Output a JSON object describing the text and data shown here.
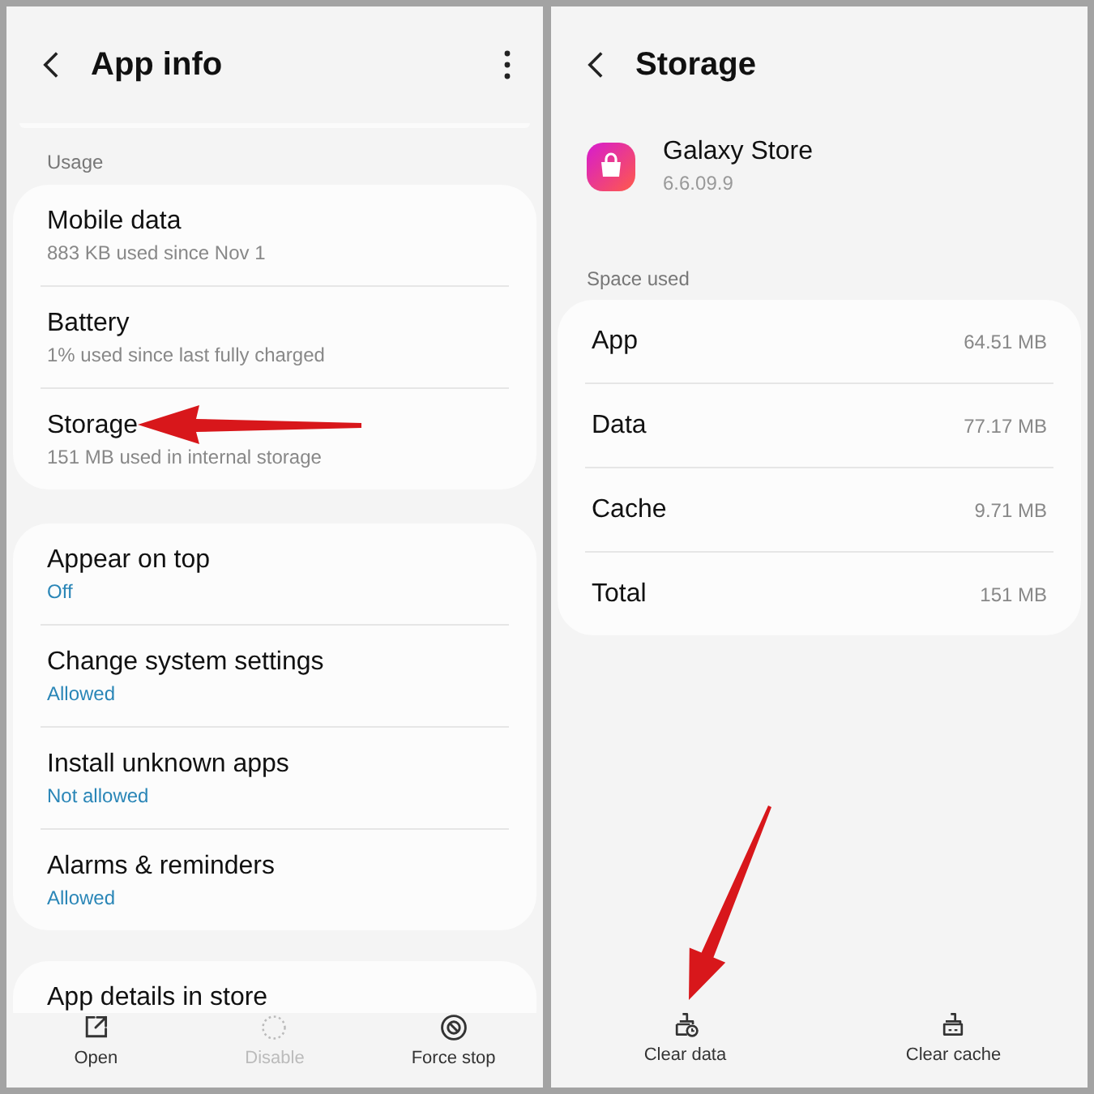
{
  "left_screen": {
    "title": "App info",
    "section_label": "Usage",
    "usage_items": [
      {
        "title": "Mobile data",
        "summary": "883 KB used since Nov 1"
      },
      {
        "title": "Battery",
        "summary": "1% used since last fully charged"
      },
      {
        "title": "Storage",
        "summary": "151 MB used in internal storage"
      }
    ],
    "permission_items": [
      {
        "title": "Appear on top",
        "summary": "Off"
      },
      {
        "title": "Change system settings",
        "summary": "Allowed"
      },
      {
        "title": "Install unknown apps",
        "summary": "Not allowed"
      },
      {
        "title": "Alarms & reminders",
        "summary": "Allowed"
      }
    ],
    "store_item": {
      "title": "App details in store"
    },
    "actions": [
      {
        "kind": "open",
        "label": "Open",
        "disabled": false
      },
      {
        "kind": "disable",
        "label": "Disable",
        "disabled": true
      },
      {
        "kind": "force_stop",
        "label": "Force stop",
        "disabled": false
      }
    ]
  },
  "right_screen": {
    "title": "Storage",
    "app": {
      "name": "Galaxy Store",
      "version": "6.6.09.9"
    },
    "section_label": "Space used",
    "rows": [
      {
        "label": "App",
        "value": "64.51 MB"
      },
      {
        "label": "Data",
        "value": "77.17 MB"
      },
      {
        "label": "Cache",
        "value": "9.71 MB"
      },
      {
        "label": "Total",
        "value": "151 MB"
      }
    ],
    "actions": [
      {
        "kind": "clear_data",
        "label": "Clear data"
      },
      {
        "kind": "clear_cache",
        "label": "Clear cache"
      }
    ]
  }
}
